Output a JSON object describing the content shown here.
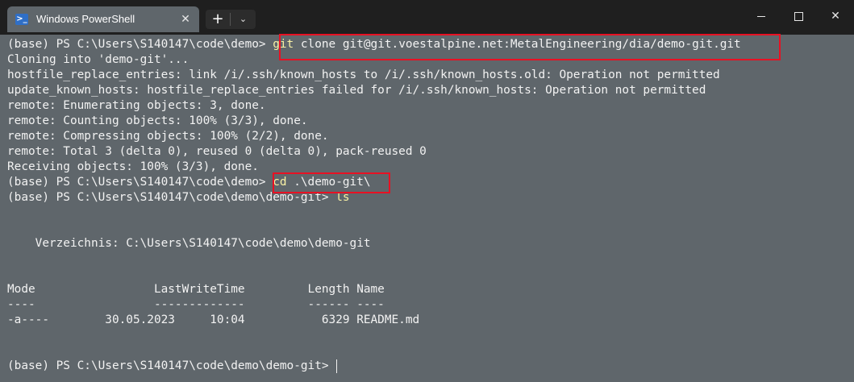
{
  "window": {
    "tab_title": "Windows PowerShell",
    "tab_icon": "powershell-icon",
    "new_tab_icon": "plus-icon",
    "dropdown_icon": "chevron-down-icon",
    "window_buttons": [
      "minimize-icon",
      "maximize-icon",
      "close-icon"
    ]
  },
  "colors": {
    "background": "#5f666b",
    "titlebar": "#1f1f1f",
    "text": "#f2f2f2",
    "command": "#f9f1a5",
    "highlight_box": "#e81123"
  },
  "terminal": {
    "lines": [
      {
        "prompt": "(base) PS C:\\Users\\S140147\\code\\demo> ",
        "cmd": "git",
        "text": " clone git@git.voestalpine.net:MetalEngineering/dia/demo-git.git"
      },
      {
        "text": "Cloning into 'demo-git'..."
      },
      {
        "text": "hostfile_replace_entries: link /i/.ssh/known_hosts to /i/.ssh/known_hosts.old: Operation not permitted"
      },
      {
        "text": "update_known_hosts: hostfile_replace_entries failed for /i/.ssh/known_hosts: Operation not permitted"
      },
      {
        "text": "remote: Enumerating objects: 3, done."
      },
      {
        "text": "remote: Counting objects: 100% (3/3), done."
      },
      {
        "text": "remote: Compressing objects: 100% (2/2), done."
      },
      {
        "text": "remote: Total 3 (delta 0), reused 0 (delta 0), pack-reused 0"
      },
      {
        "text": "Receiving objects: 100% (3/3), done."
      },
      {
        "prompt": "(base) PS C:\\Users\\S140147\\code\\demo> ",
        "cmd": "cd",
        "text": " .\\demo-git\\"
      },
      {
        "prompt": "(base) PS C:\\Users\\S140147\\code\\demo\\demo-git> ",
        "cmd": "ls"
      },
      {
        "text": ""
      },
      {
        "text": ""
      },
      {
        "text": "    Verzeichnis: C:\\Users\\S140147\\code\\demo\\demo-git"
      },
      {
        "text": ""
      },
      {
        "text": ""
      },
      {
        "text": "Mode                 LastWriteTime         Length Name"
      },
      {
        "text": "----                 -------------         ------ ----"
      },
      {
        "text": "-a----        30.05.2023     10:04           6329 README.md"
      },
      {
        "text": ""
      },
      {
        "text": ""
      },
      {
        "prompt": "(base) PS C:\\Users\\S140147\\code\\demo\\demo-git> "
      }
    ]
  }
}
